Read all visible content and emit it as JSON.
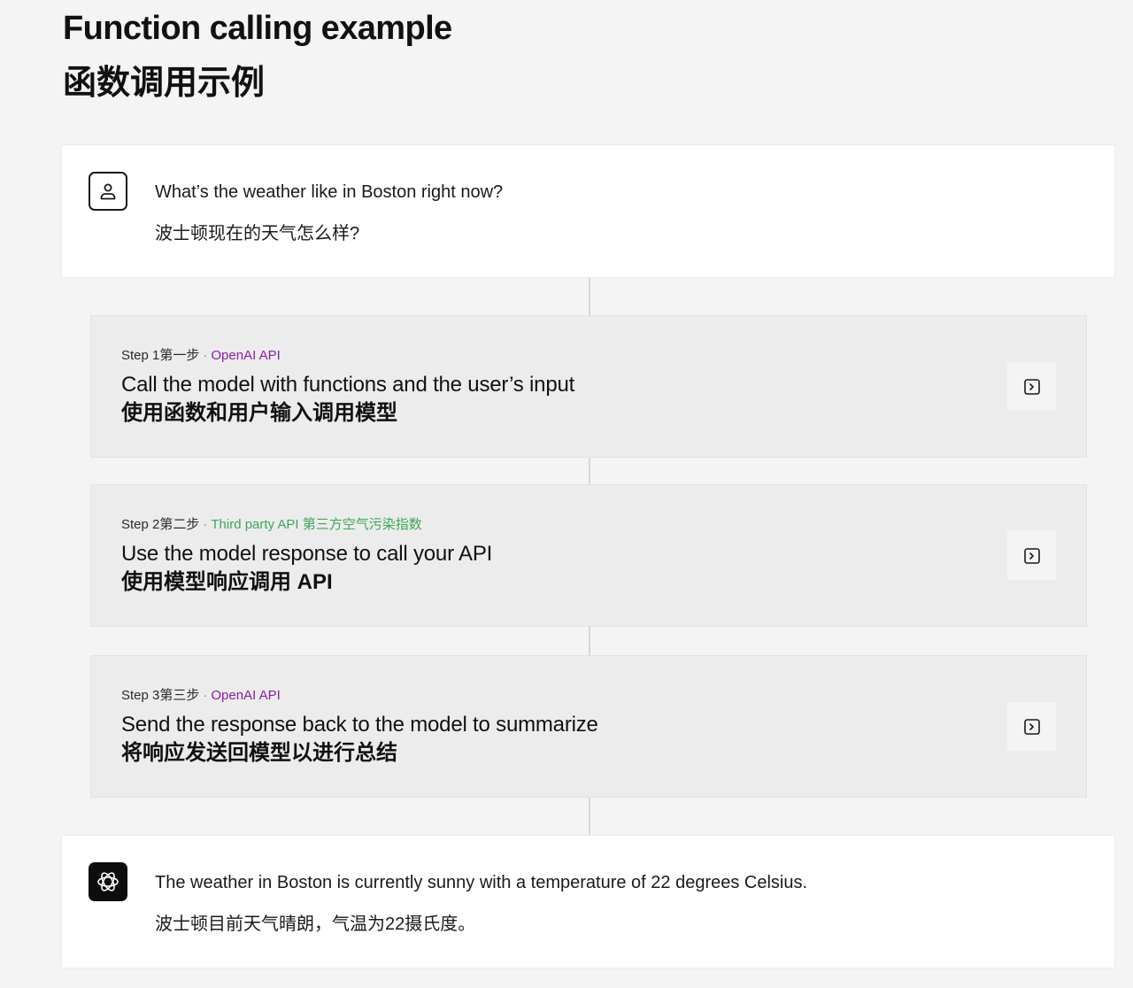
{
  "header": {
    "title_en": "Function calling example",
    "title_zh": "函数调用示例"
  },
  "user_message": {
    "avatar_icon": "user-icon",
    "text_en": "What’s the weather like in Boston right now?",
    "text_zh": "波士顿现在的天气怎么样?"
  },
  "steps": [
    {
      "step_label": "Step 1第一步",
      "separator": "·",
      "api_label": "OpenAI API",
      "api_color": "#8a1fa3",
      "heading_en": "Call the model with functions and the user’s input",
      "heading_zh": "使用函数和用户输入调用模型",
      "button_icon": "terminal-icon"
    },
    {
      "step_label": "Step 2第二步",
      "separator": "·",
      "api_label": "Third party API 第三方空气污染指数",
      "api_color": "#3ea55a",
      "heading_en": "Use the model response to call your API",
      "heading_zh": "使用模型响应调用 API",
      "button_icon": "terminal-icon"
    },
    {
      "step_label": "Step 3第三步",
      "separator": "·",
      "api_label": "OpenAI API",
      "api_color": "#8a1fa3",
      "heading_en": "Send the response back to the model to summarize",
      "heading_zh": "将响应发送回模型以进行总结",
      "button_icon": "terminal-icon"
    }
  ],
  "assistant_message": {
    "avatar_icon": "openai-logo-icon",
    "text_en": "The weather in Boston is currently sunny with a temperature of 22 degrees Celsius.",
    "text_zh": "波士顿目前天气晴朗，气温为22摄氏度。"
  }
}
